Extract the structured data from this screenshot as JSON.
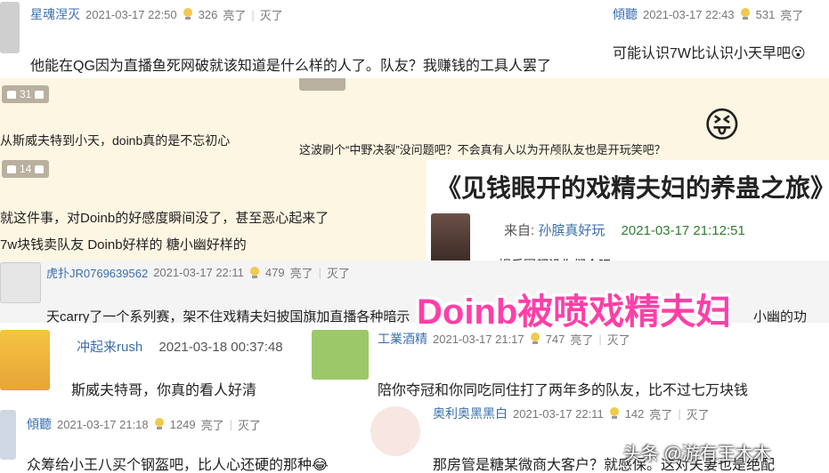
{
  "c1": {
    "user": "星魂涅灭",
    "time": "2021-03-17 22:50",
    "likes": "326",
    "approve": "亮了",
    "sep": "|",
    "hide": "灭了",
    "text": "他能在QG因为直播鱼死网破就该知道是什么样的人了。队友？我赚钱的工具人罢了"
  },
  "c2": {
    "user": "傾聽",
    "time": "2021-03-17 22:43",
    "likes": "531",
    "approve": "亮了",
    "text": "可能认识7W比认识小天早吧",
    "emoji": "😮"
  },
  "c3": {
    "likes": "31",
    "text": "从斯威夫特到小天，doinb真的是不忘初心"
  },
  "c4": {
    "text": "这波刷个“中野决裂”没问题吧？不会真有人以为开颅队友也是开玩笑吧？",
    "icon": "😝"
  },
  "c5": {
    "likes": "14",
    "line1": "就这件事，对Doinb的好感度瞬间没了，甚至恶心起来了",
    "line2": "7w块钱卖队友 Doinb好样的 糖小幽好样的"
  },
  "c6": {
    "title": "《见钱眼开的戏精夫妇的养蛊之旅》",
    "from_label": "来自:",
    "user": "孙膑真好玩",
    "time": "2021-03-17 21:12:51",
    "text": "娱乐圈都没你们会吧"
  },
  "c7": {
    "user": "虎扑JR0769639562",
    "time": "2021-03-17 22:11",
    "likes": "479",
    "approve": "亮了",
    "sep": "|",
    "hide": "灭了",
    "text_left": "天carry了一个系列赛，架不住戏精夫妇披国旗加直播各种暗示",
    "text_right": "小幽的功"
  },
  "overlay": "Doinb被喷戏精夫妇",
  "c8": {
    "user": "冲起来rush",
    "time": "2021-03-18 00:37:48",
    "text": "斯威夫特哥，你真的看人好清"
  },
  "c9": {
    "user": "工業酒精",
    "time": "2021-03-17 21:17",
    "likes": "747",
    "approve": "亮了",
    "sep": "|",
    "hide": "灭了",
    "text": "陪你夺冠和你同吃同住打了两年多的队友，比不过七万块钱"
  },
  "c10": {
    "user": "傾聽",
    "time": "2021-03-17 21:18",
    "likes": "1249",
    "approve": "亮了",
    "sep": "|",
    "hide": "灭了",
    "text": "众筹给小王八买个钢盔吧，比人心还硬的那种",
    "emoji": "😂"
  },
  "c11": {
    "user": "奥利奥黑黑白",
    "time": "2021-03-17 22:11",
    "likes": "142",
    "approve": "亮了",
    "sep": "|",
    "hide": "灭了",
    "text": "那房管是糖某微商大客户？就感保。这对夫妻也是绝配"
  },
  "watermark": "头条 @游有王木木",
  "colors": {
    "username": "#3a6fb0",
    "overlay": "#ff3fa8",
    "date_green": "#2e7d32"
  }
}
